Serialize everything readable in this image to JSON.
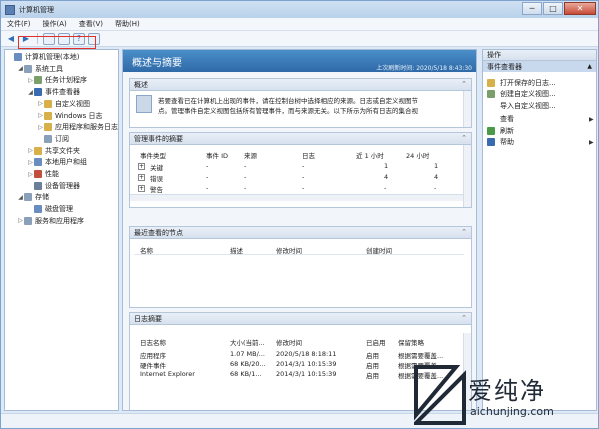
{
  "window": {
    "title": "计算机管理",
    "min": "─",
    "max": "□",
    "close": "✕"
  },
  "menu": [
    "文件(F)",
    "操作(A)",
    "查看(V)",
    "帮助(H)"
  ],
  "tree": [
    {
      "label": "计算机管理(本地)",
      "level": 0,
      "arrow": "",
      "color": "#6a8dbf"
    },
    {
      "label": "系统工具",
      "level": 1,
      "arrow": "◢",
      "color": "#8a9fb9"
    },
    {
      "label": "任务计划程序",
      "level": 2,
      "arrow": "▷",
      "color": "#7a9f6a"
    },
    {
      "label": "事件查看器",
      "level": 2,
      "arrow": "◢",
      "color": "#3a6ab0"
    },
    {
      "label": "自定义视图",
      "level": 3,
      "arrow": "▷",
      "color": "#d8b04a"
    },
    {
      "label": "Windows 日志",
      "level": 3,
      "arrow": "▷",
      "color": "#d8b04a"
    },
    {
      "label": "应用程序和服务日志",
      "level": 3,
      "arrow": "▷",
      "color": "#d8b04a"
    },
    {
      "label": "订阅",
      "level": 3,
      "arrow": "",
      "color": "#8a9fb9"
    },
    {
      "label": "共享文件夹",
      "level": 2,
      "arrow": "▷",
      "color": "#d8b04a"
    },
    {
      "label": "本地用户和组",
      "level": 2,
      "arrow": "▷",
      "color": "#6a8dbf"
    },
    {
      "label": "性能",
      "level": 2,
      "arrow": "▷",
      "color": "#c0503c"
    },
    {
      "label": "设备管理器",
      "level": 2,
      "arrow": "",
      "color": "#6a7f9a"
    },
    {
      "label": "存储",
      "level": 1,
      "arrow": "◢",
      "color": "#8a9fb9"
    },
    {
      "label": "磁盘管理",
      "level": 2,
      "arrow": "",
      "color": "#6a8dbf"
    },
    {
      "label": "服务和应用程序",
      "level": 1,
      "arrow": "▷",
      "color": "#8a9fb9"
    }
  ],
  "center": {
    "title": "概述与摘要",
    "updated": "上次刷新时间: 2020/5/18 8:43:30",
    "overview": {
      "header": "概述",
      "text1": "若要查看已在计算机上出现的事件，请在控制台树中选择相应的来源。日志或自定义视图节",
      "text2": "点。管理事件自定义视图包括所有管理事件，而与来源无关。以下所示为所有日志的集合视"
    },
    "summary": {
      "header": "管理事件的摘要",
      "columns": [
        "事件类型",
        "事件 ID",
        "来源",
        "日志",
        "近 1 小时",
        "24 小时"
      ],
      "rows": [
        [
          "关键",
          "-",
          "-",
          "-",
          "1",
          "1"
        ],
        [
          "错误",
          "-",
          "-",
          "-",
          "4",
          "4"
        ],
        [
          "警告",
          "-",
          "-",
          "-",
          "-",
          "-"
        ]
      ]
    },
    "recent": {
      "header": "最近查看的节点",
      "columns": [
        "名称",
        "描述",
        "修改时间",
        "创建时间"
      ]
    },
    "logs": {
      "header": "日志摘要",
      "columns": [
        "日志名称",
        "大小(当前...",
        "修改时间",
        "已启用",
        "保留策略"
      ],
      "rows": [
        [
          "应用程序",
          "1.07 MB/...",
          "2020/5/18 8:18:11",
          "启用",
          "根据需要覆盖..."
        ],
        [
          "硬件事件",
          "68 KB/20...",
          "2014/3/1 10:15:39",
          "启用",
          "根据需要覆盖..."
        ],
        [
          "Internet Explorer",
          "68 KB/1...",
          "2014/3/1 10:15:39",
          "启用",
          "根据需要覆盖..."
        ]
      ]
    }
  },
  "actions": {
    "header": "操作",
    "sub": "事件查看器",
    "items": [
      {
        "label": "打开保存的日志...",
        "color": "#d8b04a",
        "arrow": ""
      },
      {
        "label": "创建自定义视图...",
        "color": "#7a9f6a",
        "arrow": ""
      },
      {
        "label": "导入自定义视图...",
        "color": "",
        "arrow": ""
      },
      {
        "label": "查看",
        "color": "",
        "arrow": "▶"
      },
      {
        "label": "刷新",
        "color": "#4a9a4a",
        "arrow": ""
      },
      {
        "label": "帮助",
        "color": "#3a6ab0",
        "arrow": "▶"
      }
    ]
  },
  "watermark": {
    "big": "爱纯净",
    "small": "aichunjing.com"
  }
}
